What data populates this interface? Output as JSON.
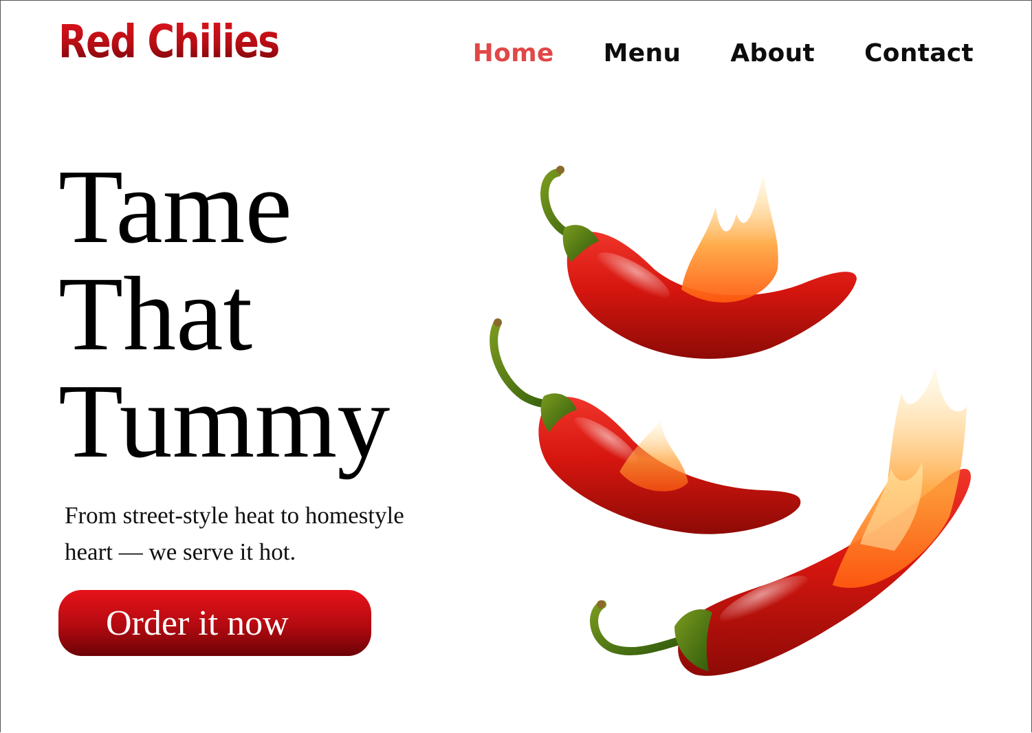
{
  "brand": {
    "name": "Red Chilies"
  },
  "nav": {
    "items": [
      {
        "label": "Home",
        "active": true
      },
      {
        "label": "Menu",
        "active": false
      },
      {
        "label": "About",
        "active": false
      },
      {
        "label": "Contact",
        "active": false
      }
    ]
  },
  "hero": {
    "title_lines": [
      "Tame",
      "That",
      "Tummy"
    ],
    "subtitle": "From street-style heat to homestyle heart — we serve it hot.",
    "cta_label": "Order it now",
    "image_icon": "flaming-chili-peppers"
  },
  "colors": {
    "accent": "#e04848",
    "brand_red": "#d0141c",
    "dark_red": "#6c0206",
    "text": "#000000"
  }
}
